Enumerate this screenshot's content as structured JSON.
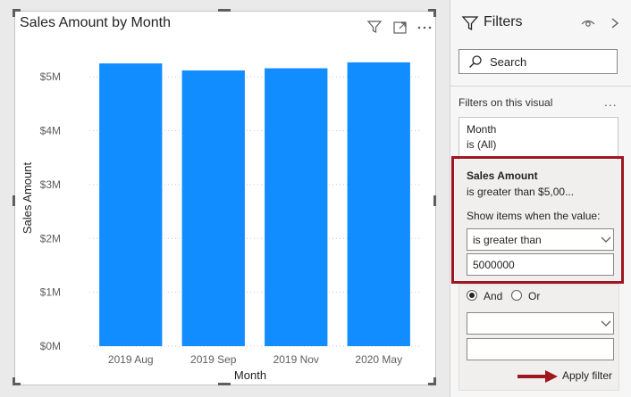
{
  "visual": {
    "title": "Sales Amount by Month"
  },
  "chart_data": {
    "type": "bar",
    "categories": [
      "2019 Aug",
      "2019 Sep",
      "2019 Nov",
      "2020 May"
    ],
    "values": [
      5.25,
      5.12,
      5.16,
      5.27
    ],
    "ylim": [
      0,
      5.5
    ],
    "yticks": [
      0,
      1,
      2,
      3,
      4,
      5
    ],
    "ytick_labels": [
      "$0M",
      "$1M",
      "$2M",
      "$3M",
      "$4M",
      "$5M"
    ],
    "xlabel": "Month",
    "ylabel": "Sales Amount",
    "bar_color": "#118dff",
    "grid": true
  },
  "filters_pane": {
    "title": "Filters",
    "search_placeholder": "Search",
    "section_label": "Filters on this visual",
    "section_more": "...",
    "month_card": {
      "field": "Month",
      "summary": "is (All)"
    },
    "sales_card": {
      "field": "Sales Amount",
      "summary": "is greater than $5,00...",
      "show_items_label": "Show items when the value:",
      "condition_value": "is greater than",
      "amount_value": "5000000",
      "and_label": "And",
      "or_label": "Or",
      "apply_label": "Apply filter"
    }
  },
  "colors": {
    "highlight_border": "#a0161f",
    "arrow": "#a0161f",
    "bar": "#118dff"
  }
}
